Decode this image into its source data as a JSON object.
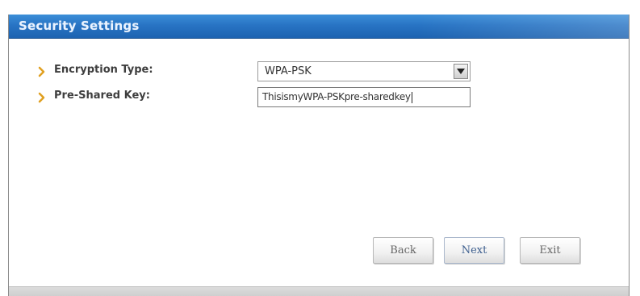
{
  "window": {
    "title": "Security Settings"
  },
  "form": {
    "encryption_type": {
      "label": "Encryption Type:",
      "selected": "WPA-PSK"
    },
    "pre_shared_key": {
      "label": "Pre-Shared Key:",
      "value": "ThisismyWPA-PSKpre-sharedkey"
    }
  },
  "buttons": {
    "back": "Back",
    "next": "Next",
    "exit": "Exit"
  },
  "colors": {
    "titlebar": "#2874c4",
    "bullet": "#e0a020"
  },
  "icons": {
    "bullet": "chevron-right-icon",
    "dropdown": "dropdown-arrow-icon"
  }
}
